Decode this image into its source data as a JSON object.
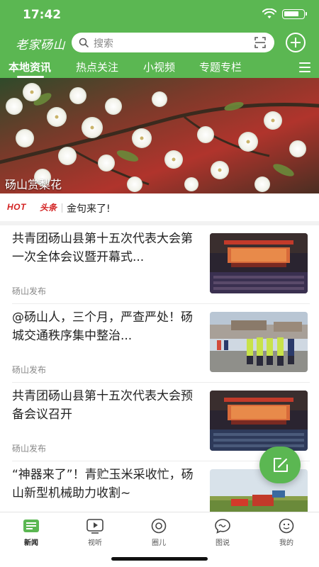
{
  "status_bar": {
    "time": "17:42"
  },
  "header": {
    "logo_text": "老家砀山",
    "search": {
      "placeholder": "搜索"
    },
    "tabs": [
      {
        "label": "本地资讯",
        "active": true
      },
      {
        "label": "热点关注",
        "active": false
      },
      {
        "label": "小视频",
        "active": false
      },
      {
        "label": "专题专栏",
        "active": false
      }
    ],
    "accent_color": "#5bb752"
  },
  "banner": {
    "caption": "砀山赏梨花"
  },
  "hot": {
    "logo_en": "HOT",
    "logo_cn": "头条",
    "text": "金句来了!"
  },
  "news": [
    {
      "title": "共青团砀山县第十五次代表大会第一次全体会议暨开幕式...",
      "source": "砀山发布",
      "thumb": "meeting-hall"
    },
    {
      "title": "@砀山人，三个月，严查严处！砀城交通秩序集中整治...",
      "source": "砀山发布",
      "thumb": "traffic-police"
    },
    {
      "title": "共青团砀山县第十五次代表大会预备会议召开",
      "source": "砀山发布",
      "thumb": "meeting-hall"
    },
    {
      "title": "“神器来了”！青贮玉米采收忙，砀山新型机械助力收割~",
      "source": "",
      "thumb": "harvester"
    }
  ],
  "tabbar": [
    {
      "label": "新闻",
      "icon": "news-icon",
      "active": true
    },
    {
      "label": "视听",
      "icon": "video-icon",
      "active": false
    },
    {
      "label": "圈儿",
      "icon": "circle-icon",
      "active": false
    },
    {
      "label": "图说",
      "icon": "chat-icon",
      "active": false
    },
    {
      "label": "我的",
      "icon": "profile-icon",
      "active": false
    }
  ]
}
